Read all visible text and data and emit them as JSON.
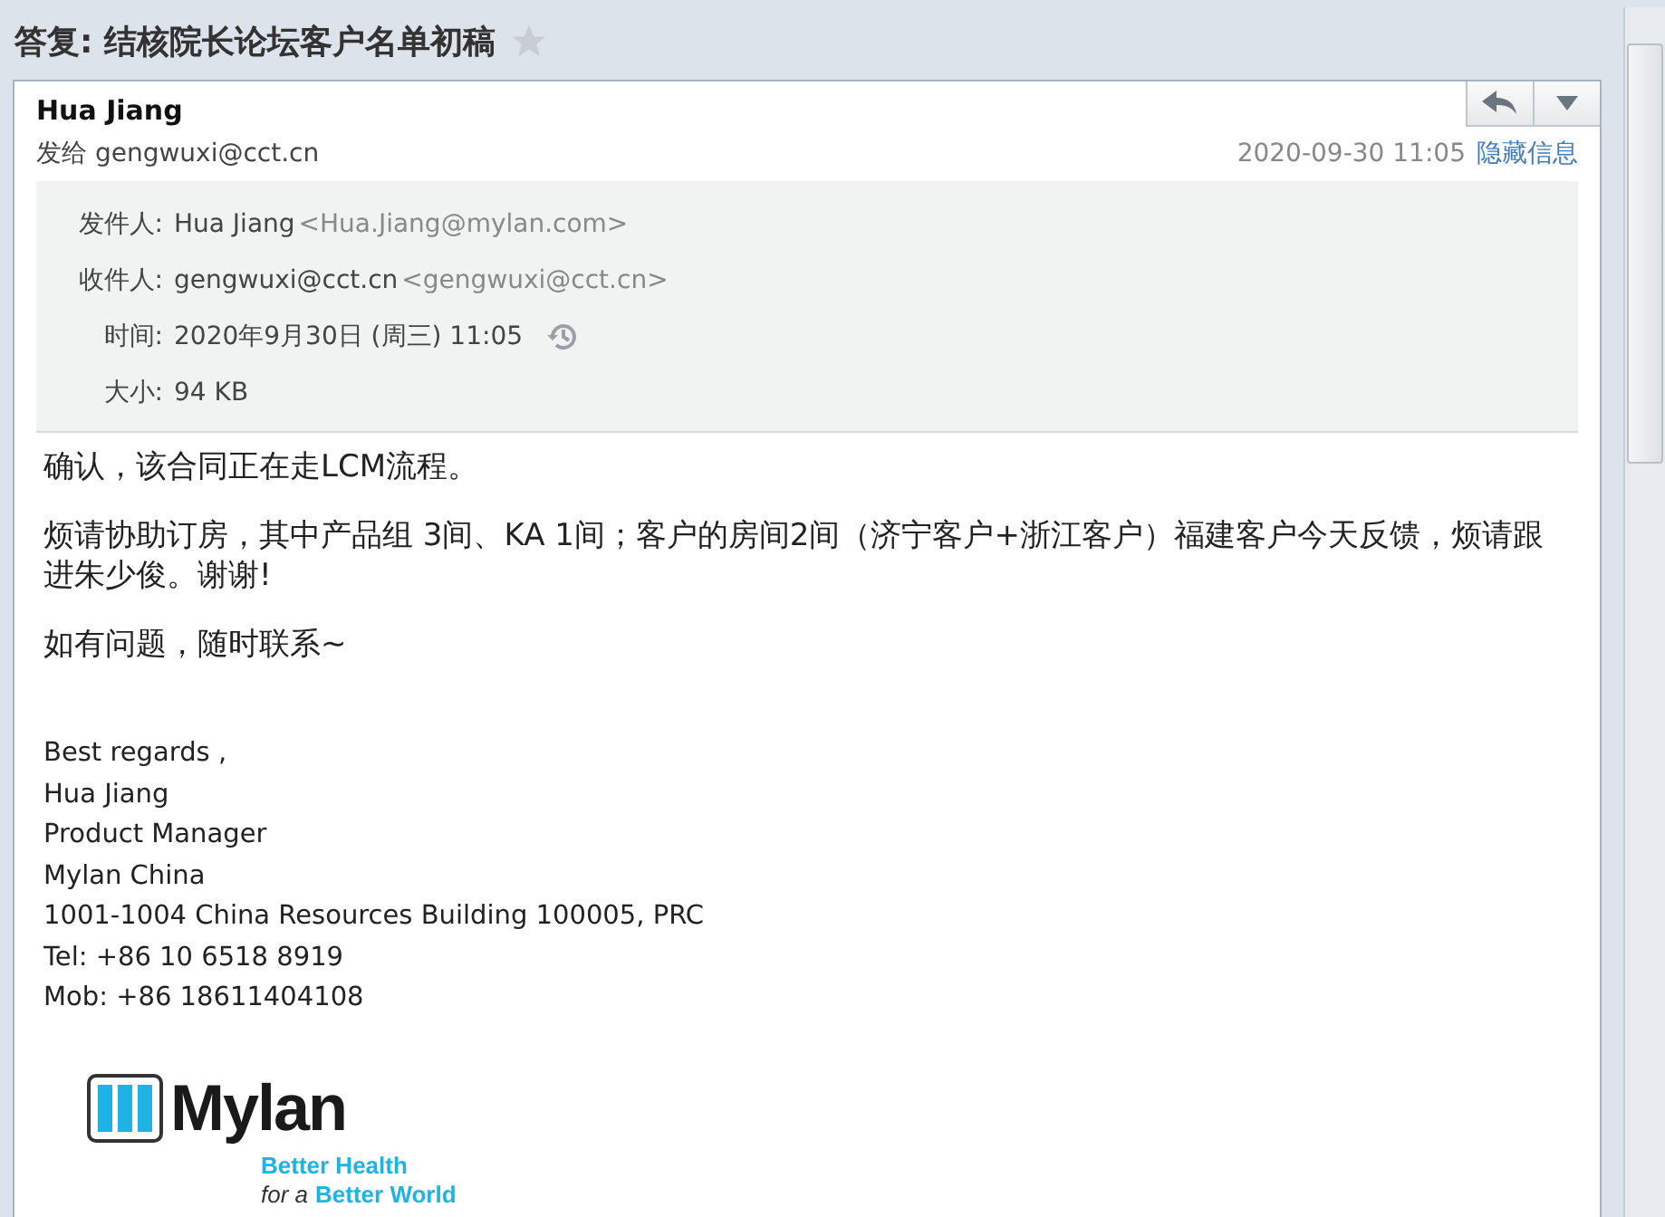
{
  "subject": {
    "title": "答复: 结核院长论坛客户名单初稿",
    "starred": false
  },
  "message": {
    "sender": "Hua Jiang",
    "to_label": "发给",
    "to": "gengwuxi@cct.cn",
    "date": "2020-09-30 11:05",
    "toggle_link": "隐藏信息",
    "details": [
      {
        "label": "发件人:",
        "value": "Hua Jiang",
        "address": "<Hua.Jiang@mylan.com>",
        "kind": "address"
      },
      {
        "label": "收件人:",
        "value": "gengwuxi@cct.cn",
        "address": "<gengwuxi@cct.cn>",
        "kind": "address"
      },
      {
        "label": "时间:",
        "value": "2020年9月30日 (周三) 11:05",
        "kind": "time"
      },
      {
        "label": "大小:",
        "value": "94 KB",
        "kind": "plain"
      }
    ],
    "body": [
      "确认，该合同正在走LCM流程。",
      "烦请协助订房，其中产品组 3间、KA 1间；客户的房间2间（济宁客户+浙江客户）福建客户今天反馈，烦请跟进朱少俊。谢谢!",
      "如有问题，随时联系~"
    ],
    "signature": [
      "Best regards ,",
      "Hua Jiang",
      "Product Manager",
      "Mylan China",
      "1001-1004 China Resources Building 100005, PRC",
      "Tel: +86 10 6518 8919",
      "Mob: +86 18611404108"
    ],
    "logo": {
      "name": "Mylan",
      "tagline": "Better Health",
      "tagline_prefix": "for a",
      "tagline_end": "Better World"
    }
  }
}
